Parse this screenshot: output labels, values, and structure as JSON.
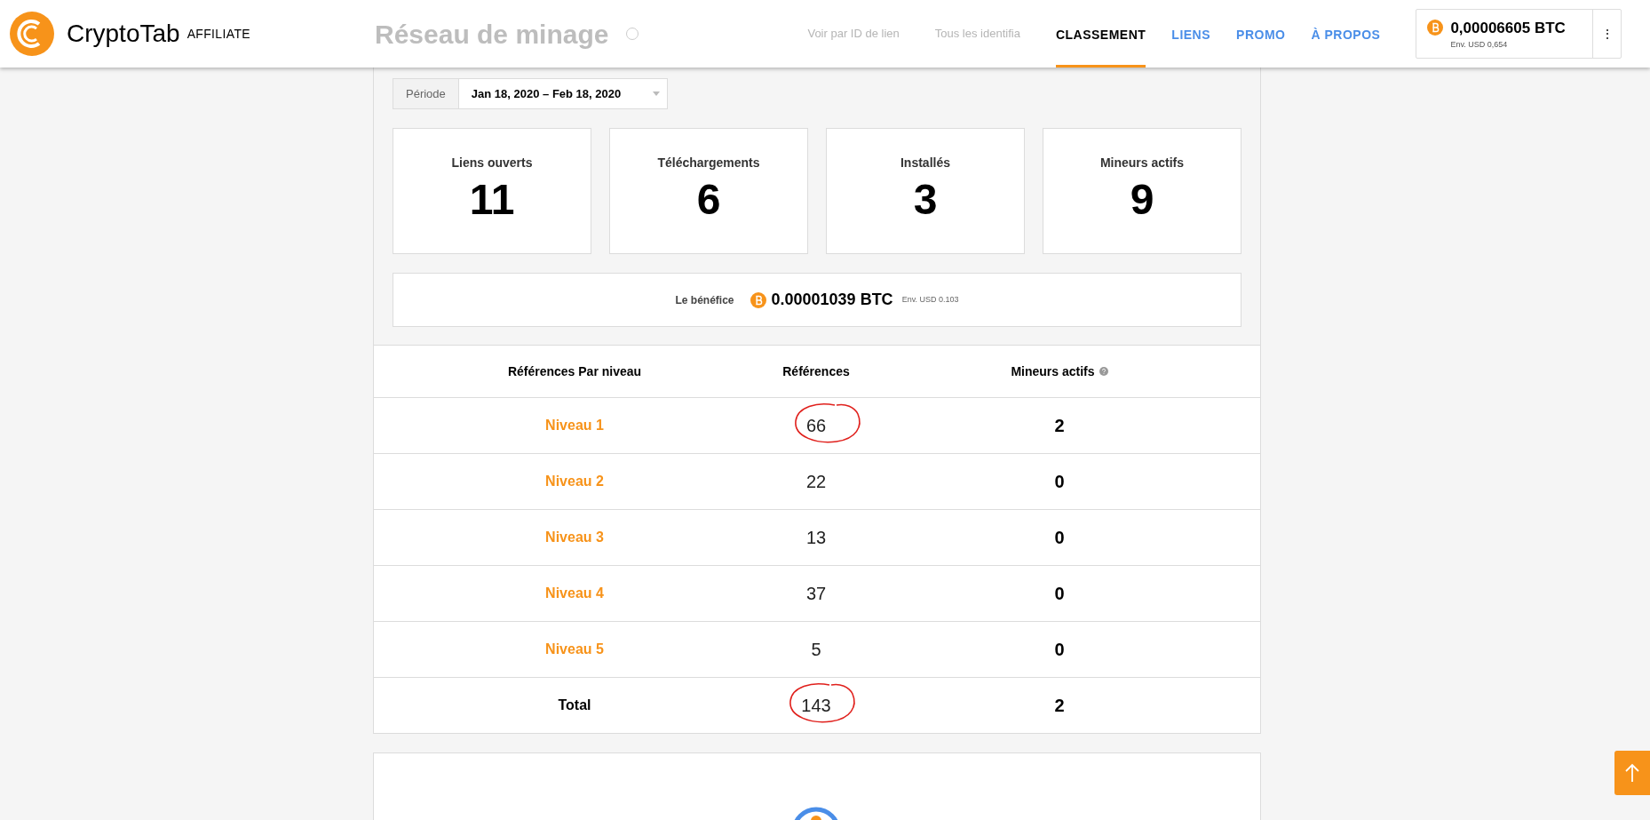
{
  "header": {
    "brand": "CryptoTab",
    "brand_suffix": "AFFILIATE",
    "faded_title": "Réseau de minage",
    "faded_links": [
      "Voir par ID de lien",
      "Tous les identifia"
    ],
    "nav": [
      {
        "label": "CLASSEMENT",
        "selected": true
      },
      {
        "label": "LIENS",
        "selected": false
      },
      {
        "label": "PROMO",
        "selected": false
      },
      {
        "label": "À PROPOS",
        "selected": false
      }
    ],
    "balance": {
      "amount": "0,00006605 BTC",
      "usd": "Env. USD 0,654",
      "menu": "⋮"
    }
  },
  "period": {
    "label": "Période",
    "value": "Jan 18, 2020 – Feb 18, 2020"
  },
  "stats": [
    {
      "label": "Liens ouverts",
      "value": "11"
    },
    {
      "label": "Téléchargements",
      "value": "6"
    },
    {
      "label": "Installés",
      "value": "3"
    },
    {
      "label": "Mineurs actifs",
      "value": "9"
    }
  ],
  "profit": {
    "label": "Le bénéfice",
    "amount": "0.00001039 BTC",
    "usd": "Env. USD 0.103"
  },
  "table": {
    "columns": [
      "Références Par niveau",
      "Références",
      "Mineurs actifs"
    ],
    "rows": [
      {
        "level": "Niveau 1",
        "references": "66",
        "active": "2",
        "circled": true
      },
      {
        "level": "Niveau 2",
        "references": "22",
        "active": "0",
        "circled": false
      },
      {
        "level": "Niveau 3",
        "references": "13",
        "active": "0",
        "circled": false
      },
      {
        "level": "Niveau 4",
        "references": "37",
        "active": "0",
        "circled": false
      },
      {
        "level": "Niveau 5",
        "references": "5",
        "active": "0",
        "circled": false
      }
    ],
    "total": {
      "label": "Total",
      "references": "143",
      "active": "2",
      "circled": true
    }
  }
}
